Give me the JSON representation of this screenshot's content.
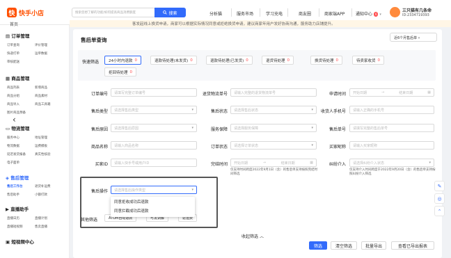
{
  "header": {
    "logo_glyph": "快",
    "app_name": "快手小店",
    "search_placeholder": "搜索您想了解的功能/如何提高商品消费额度",
    "search_button": "搜索",
    "nav": [
      "分析猫",
      "服务市场",
      "学习充电",
      "商友圈",
      "商家端APP",
      "通知中心"
    ],
    "notify_badge": "6",
    "shop_name": "三只猫有几条命",
    "shop_id": "ID:2334719393"
  },
  "sidebar": {
    "truncated_top": "首页",
    "sections": [
      {
        "title": "订单管理",
        "items": [
          "订单查询",
          "评价管理",
          "快递打单",
          "运单数据",
          "审核配送"
        ]
      },
      {
        "title": "商品管理",
        "items": [
          "商品列表",
          "新增商品",
          "商品分组",
          "商品素材",
          "商品导入",
          "商品工具箱",
          "图片商品预备"
        ]
      },
      {
        "title": "物流管理",
        "items": [
          "服务中心",
          "地址管理",
          "物流数据",
          "运费模板",
          "延迟发货报备",
          "真实性核验",
          "电子面单"
        ]
      },
      {
        "title": "售后管理",
        "items": [
          "售后工作台",
          "退货补运费",
          "售后助手",
          "小额打款"
        ]
      },
      {
        "title": "直播助手",
        "items": [
          "直播日历",
          "直播计划",
          "直播短视频",
          "售卖直播"
        ]
      },
      {
        "title": "短视频中心",
        "items": []
      }
    ]
  },
  "notice": "客发起线上换货申请，商家可以根据实际情况同意或拒绝换货申请，建议商家年用户发好协商沟通，服务助力店铺提升。",
  "page": {
    "title": "售后单查询",
    "range_select": "近6个月售后单",
    "quick_filter_label": "快速筛选",
    "quick_filters": [
      {
        "label": "24小时内退款",
        "count": "0"
      },
      {
        "label": "退款待处理(未发货)",
        "count": "0"
      },
      {
        "label": "退款待处理(已发货)",
        "count": "0"
      },
      {
        "label": "退货待处理",
        "count": "0"
      },
      {
        "label": "换货待处理",
        "count": "0"
      },
      {
        "label": "待卖家收货",
        "count": "0"
      },
      {
        "label": "拒回待处理",
        "count": "0"
      }
    ]
  },
  "form": {
    "order_no": {
      "label": "订单编号",
      "placeholder": "请填写完整订单编号"
    },
    "return_waybill": {
      "label": "退货物流单号",
      "placeholder": "请输入完整的退货物流单号"
    },
    "apply_time": {
      "label": "申请时间",
      "start": "开始日期",
      "end": "结束日期"
    },
    "after_type": {
      "label": "售后类型",
      "placeholder": "请选择售后类型"
    },
    "after_status": {
      "label": "售后状态",
      "placeholder": "请选择售后状态"
    },
    "receiver_phone": {
      "label": "收货人手机号",
      "placeholder": "请输入正确的手机号"
    },
    "after_reason": {
      "label": "售后原因",
      "placeholder": "请选择售后原因"
    },
    "service_guarantee": {
      "label": "服务保障",
      "placeholder": "请选择服务保障"
    },
    "after_no": {
      "label": "售后单号",
      "placeholder": "请填写完整的售后单号"
    },
    "product_name": {
      "label": "商品名称",
      "placeholder": "请输入商品名称"
    },
    "order_status": {
      "label": "订单状态",
      "placeholder": "请选择订单状态"
    },
    "buyer_nick": {
      "label": "买家昵称",
      "placeholder": "请输入买家昵称"
    },
    "buyer_id": {
      "label": "买家ID",
      "placeholder": "请输入快手号或用户ID"
    },
    "complete_time": {
      "label": "完结时间",
      "start": "开始日期",
      "end": "结束日期",
      "note": "仅支持时间跨度2022年9月1日（含）的售后单支持按照完结时间筛选"
    },
    "arbitration": {
      "label": "纠纷介入",
      "placeholder": "请选择纠纷介入状态",
      "note": "仅支持介入时间跨度于2022年9月20日（含）的售后单支持按照纠纷介入筛选"
    },
    "after_action": {
      "label": "售后操作",
      "placeholder": "请选择售后操作类型"
    },
    "dropdown_options": [
      "同意拒收成功后退款",
      "同意拦截成功后退款"
    ],
    "other": {
      "label": "其他筛选",
      "chips": [
        "ATOM自动退款",
        "可发调解",
        "返运费"
      ]
    }
  },
  "actions": {
    "collapse": "收起筛选",
    "search": "筛选",
    "reset": "清空筛选",
    "batch_export": "批量导出",
    "view_export": "查看已导出报表"
  }
}
